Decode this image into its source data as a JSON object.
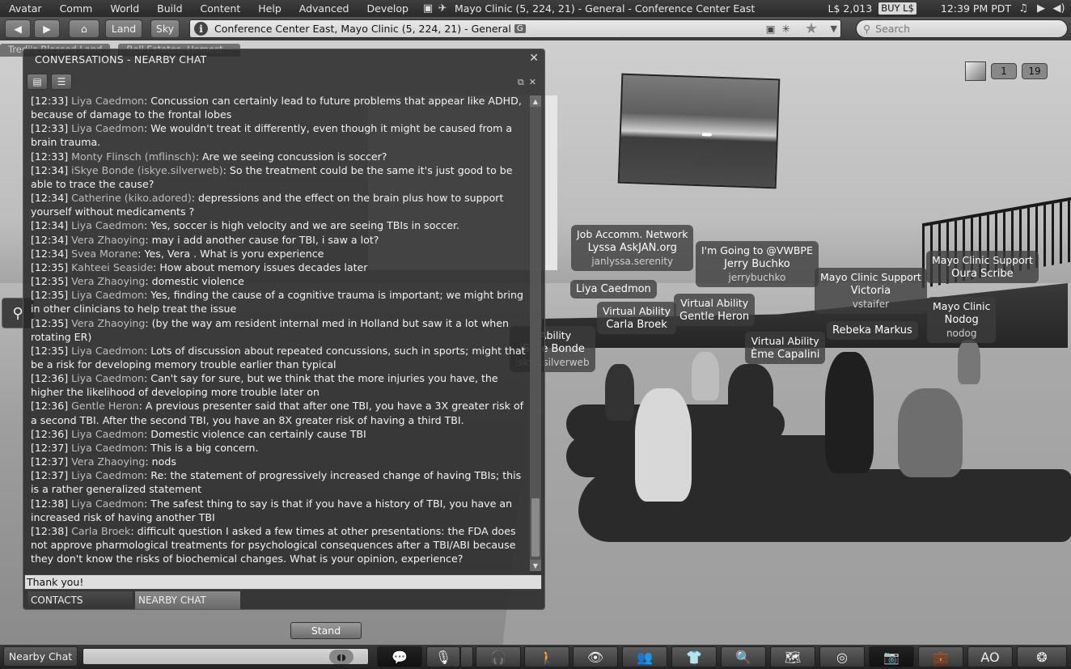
{
  "menu": {
    "items": [
      "Avatar",
      "Comm",
      "World",
      "Build",
      "Content",
      "Help",
      "Advanced",
      "Develop"
    ],
    "window_title": "Mayo Clinic (5, 224, 21) - General - Conference Center East",
    "balance": "L$ 2,013",
    "buy_label": "BUY L$",
    "time": "12:39 PM PDT"
  },
  "nav": {
    "land_label": "Land",
    "sky_label": "Sky",
    "location": "Conference Center East, Mayo Clinic (5, 224, 21) - General",
    "maturity_badge": "G",
    "search_placeholder": "Search"
  },
  "favorites": [
    "Tredi's Blessed Land",
    "Bell Estates, Homest..."
  ],
  "conversations": {
    "title": "CONVERSATIONS - NEARBY CHAT",
    "input_value": "Thank you!",
    "tabs": [
      {
        "label": "CONTACTS",
        "active": false
      },
      {
        "label": "NEARBY CHAT",
        "active": true
      }
    ],
    "messages": [
      {
        "time": "[12:33]",
        "speaker": "Liya Caedmon",
        "text": ": Concussion can certainly lead to future problems that appear like ADHD, because of damage to the frontal lobes"
      },
      {
        "time": "[12:33]",
        "speaker": "Liya Caedmon",
        "text": ": We wouldn't treat it differently, even though it might be caused from a brain trauma."
      },
      {
        "time": "[12:33]",
        "speaker": "Monty Flinsch (mflinsch)",
        "text": ": Are we seeing concussion is soccer?"
      },
      {
        "time": "[12:34]",
        "speaker": "iSkye Bonde (iskye.silverweb)",
        "text": ": So the treatment could be the same it's just good to be able to trace the cause?"
      },
      {
        "time": "[12:34]",
        "speaker": "Catherine (kiko.adored)",
        "text": ": depressions and the effect on the brain plus how to support yourself without medicaments ?"
      },
      {
        "time": "[12:34]",
        "speaker": "Liya Caedmon",
        "text": ": Yes, soccer is high velocity and we are seeing TBIs in soccer."
      },
      {
        "time": "[12:34]",
        "speaker": "Vera Zhaoying",
        "text": ": may i add another cause for TBI, i saw a lot?"
      },
      {
        "time": "[12:34]",
        "speaker": "Svea Morane",
        "text": ": Yes, Vera . What is yoru experience"
      },
      {
        "time": "[12:35]",
        "speaker": "Kahteei Seaside",
        "text": ": How about memory issues decades later"
      },
      {
        "time": "[12:35]",
        "speaker": "Vera Zhaoying",
        "text": ": domestic violence"
      },
      {
        "time": "[12:35]",
        "speaker": "Liya Caedmon",
        "text": ": Yes, finding the cause of a cognitive trauma is important; we might bring in other clinicians to help treat the issue"
      },
      {
        "time": "[12:35]",
        "speaker": "Vera Zhaoying",
        "text": ": (by the way am resident internal med in Holland but saw it a lot when rotating ER)"
      },
      {
        "time": "[12:35]",
        "speaker": "Liya Caedmon",
        "text": ": Lots of discussion about repeated concussions, such in sports; might that be a risk for developing memory trouble earlier than typical"
      },
      {
        "time": "[12:36]",
        "speaker": "Liya Caedmon",
        "text": ": Can't say for sure, but we think that the more injuries you have, the higher the likelihood of developing more trouble later on"
      },
      {
        "time": "[12:36]",
        "speaker": "Gentle Heron",
        "text": ": A previous presenter said that after one TBI, you have a 3X greater risk of a second TBI. After the second TBI, you have an 8X greater risk of having a third TBI."
      },
      {
        "time": "[12:36]",
        "speaker": "Liya Caedmon",
        "text": ": Domestic violence can certainly cause TBI"
      },
      {
        "time": "[12:37]",
        "speaker": "Liya Caedmon",
        "text": ": This is a big concern."
      },
      {
        "time": "[12:37]",
        "speaker": "Vera Zhaoying",
        "text": ": nods"
      },
      {
        "time": "[12:37]",
        "speaker": "Liya Caedmon",
        "text": ": Re: the statement of progressively increased change of having TBIs; this is a rather generalized statement"
      },
      {
        "time": "[12:38]",
        "speaker": "Liya Caedmon",
        "text": ": The safest thing to say is that if you have a history of TBI, you have an increased risk of having another TBI"
      },
      {
        "time": "[12:38]",
        "speaker": "Carla Broek",
        "text": ": difficult question I asked a few times at other presentations: the FDA does not approve pharmological treatments for psychological consequences after a TBI/ABI because they don't know the risks of biochemical changes. What is your opinion, experience?"
      }
    ]
  },
  "people": {
    "counter_1": "1",
    "counter_2": "19"
  },
  "name_tags": [
    {
      "lines": [
        "Job Accomm. Network",
        "Lyssa AskJAN.org",
        "janlyssa.serenity"
      ]
    },
    {
      "lines": [
        "I'm Going to @VWBPE",
        "Jerry Buchko",
        "jerrybuchko"
      ]
    },
    {
      "lines": [
        "Mayo Clinic Support",
        "Victoria",
        "vstaifer"
      ]
    },
    {
      "lines": [
        "Mayo Clinic Support",
        "Oura Scribe"
      ]
    },
    {
      "lines": [
        "Liya Caedmon"
      ]
    },
    {
      "lines": [
        "Virtual Ability",
        "Carla Broek"
      ]
    },
    {
      "lines": [
        "Virtual Ability",
        "Gentle Heron"
      ]
    },
    {
      "lines": [
        "Mayo Clinic",
        "Nodog",
        "nodog"
      ]
    },
    {
      "lines": [
        "Rebeka Markus"
      ]
    },
    {
      "lines": [
        "Virtual Ability",
        "Ème Capalini"
      ]
    },
    {
      "lines": [
        "l Ability",
        "iSkye Bonde",
        "iskye.silverweb"
      ]
    }
  ],
  "stand_label": "Stand",
  "bottombar": {
    "nearby_label": "Nearby Chat",
    "ao_label": "AO"
  }
}
